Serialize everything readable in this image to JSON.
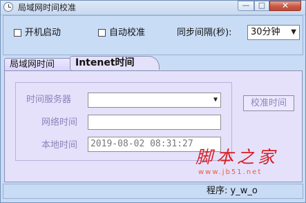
{
  "window": {
    "title": "局域网时间校准"
  },
  "title_buttons": {
    "minimize": "—",
    "maximize": "□",
    "close": "✕"
  },
  "options": {
    "startup_label": "开机启动",
    "auto_calibrate_label": "自动校准",
    "sync_interval_label": "同步间隔(秒):",
    "sync_interval_value": "30分钟",
    "dropdown_arrow": "▼"
  },
  "tabs": [
    {
      "label": "局域网时间"
    },
    {
      "label": "Intenet时间"
    }
  ],
  "form": {
    "time_server_label": "时间服务器",
    "time_server_value": "",
    "network_time_label": "网络时间",
    "network_time_value": "",
    "local_time_label": "本地时间",
    "local_time_value": "2019-08-02 08:31:27",
    "calibrate_button": "校准时间"
  },
  "watermark": {
    "logo_text": "脚本之家",
    "url": "www.jb51.net"
  },
  "status": {
    "text": "程序: y_w_o"
  },
  "colors": {
    "window_bg": "#c9dcf5",
    "panel_bg": "#e5e1fb",
    "disabled_text": "#8a84ba",
    "watermark_red": "#d71f24"
  }
}
